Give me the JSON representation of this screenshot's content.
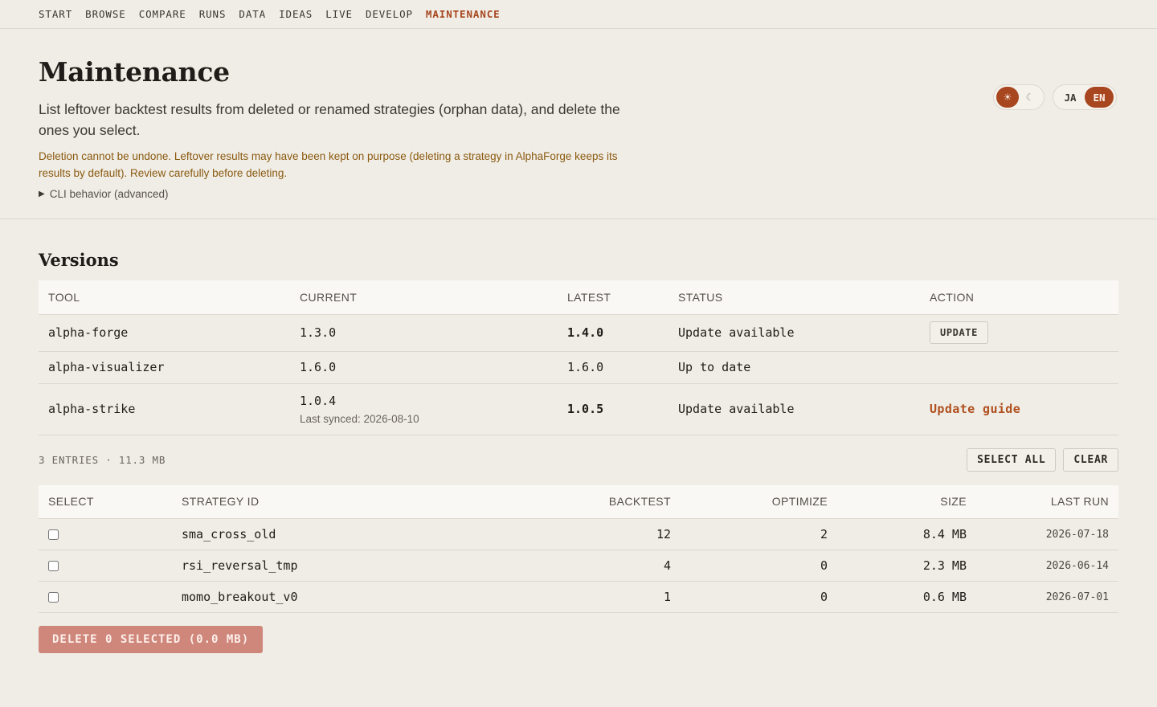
{
  "nav": {
    "items": [
      {
        "label": "START"
      },
      {
        "label": "BROWSE"
      },
      {
        "label": "COMPARE"
      },
      {
        "label": "RUNS"
      },
      {
        "label": "DATA"
      },
      {
        "label": "IDEAS"
      },
      {
        "label": "LIVE"
      },
      {
        "label": "DEVELOP"
      },
      {
        "label": "MAINTENANCE",
        "active": true
      }
    ]
  },
  "header": {
    "title": "Maintenance",
    "lead": "List leftover backtest results from deleted or renamed strategies (orphan data), and delete the ones you select.",
    "warning": "Deletion cannot be undone. Leftover results may have been kept on purpose (deleting a strategy in AlphaForge keeps its results by default). Review carefully before deleting.",
    "details_label": "CLI behavior (advanced)"
  },
  "theme_toggle": {
    "light_icon": "sun-icon",
    "light_glyph": "☀",
    "dark_icon": "moon-icon",
    "dark_glyph": "☾",
    "selected": "light"
  },
  "language": {
    "options": [
      "JA",
      "EN"
    ],
    "selected": "EN"
  },
  "versions": {
    "title": "Versions",
    "columns": [
      "TOOL",
      "CURRENT",
      "LATEST",
      "STATUS",
      "ACTION"
    ],
    "rows": [
      {
        "tool": "alpha-forge",
        "current": "1.3.0",
        "latest": "1.4.0",
        "status": "Update available",
        "action": "UPDATE"
      },
      {
        "tool": "alpha-visualizer",
        "current": "1.6.0",
        "latest": "1.6.0",
        "status": "Up to date",
        "action": ""
      },
      {
        "tool": "alpha-strike",
        "current": "1.0.4",
        "synced": "Last synced: 2026-08-10",
        "latest": "1.0.5",
        "status": "Update available",
        "action": "Update guide"
      }
    ]
  },
  "entries": {
    "summary": "3 ENTRIES · 11.3 MB",
    "select_all_label": "SELECT ALL",
    "clear_label": "CLEAR",
    "columns": [
      "SELECT",
      "STRATEGY ID",
      "BACKTEST",
      "OPTIMIZE",
      "SIZE",
      "LAST RUN"
    ],
    "rows": [
      {
        "id": "sma_cross_old",
        "backtest": "12",
        "optimize": "2",
        "size": "8.4 MB",
        "last_run": "2026-07-18",
        "selected": false
      },
      {
        "id": "rsi_reversal_tmp",
        "backtest": "4",
        "optimize": "0",
        "size": "2.3 MB",
        "last_run": "2026-06-14",
        "selected": false
      },
      {
        "id": "momo_breakout_v0",
        "backtest": "1",
        "optimize": "0",
        "size": "0.6 MB",
        "last_run": "2026-07-01",
        "selected": false
      }
    ],
    "delete_label": "DELETE 0 SELECTED (0.0 MB)"
  },
  "colors": {
    "accent": "#a7461f",
    "warning": "#8a5a10",
    "delete_disabled": "#cf867b",
    "background": "#f0ede6"
  }
}
